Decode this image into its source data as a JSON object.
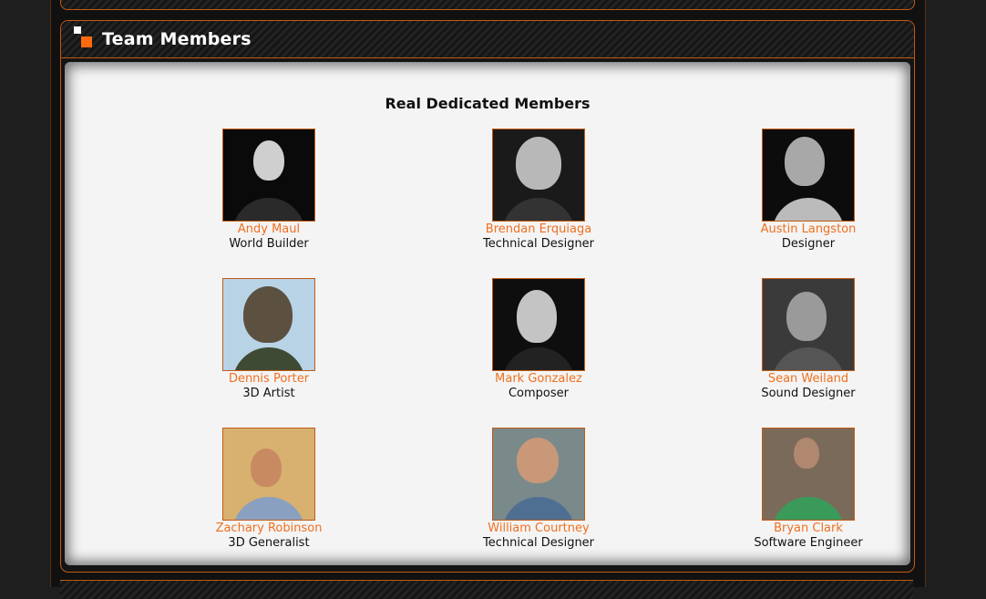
{
  "panel": {
    "title": "Team Members"
  },
  "section": {
    "heading": "Real Dedicated Members"
  },
  "members": [
    {
      "name": "Andy Maul",
      "role": "World Builder"
    },
    {
      "name": "Brendan Erquiaga",
      "role": "Technical Designer"
    },
    {
      "name": "Austin Langston",
      "role": "Designer"
    },
    {
      "name": "Dennis Porter",
      "role": "3D Artist"
    },
    {
      "name": "Mark Gonzalez",
      "role": "Composer"
    },
    {
      "name": "Sean Weiland",
      "role": "Sound Designer"
    },
    {
      "name": "Zachary Robinson",
      "role": "3D Generalist"
    },
    {
      "name": "William Courtney",
      "role": "Technical Designer"
    },
    {
      "name": "Bryan Clark",
      "role": "Software Engineer"
    }
  ],
  "colors": {
    "accent": "#f07020",
    "border": "#c25a14",
    "body_bg": "#f4f4f4"
  }
}
